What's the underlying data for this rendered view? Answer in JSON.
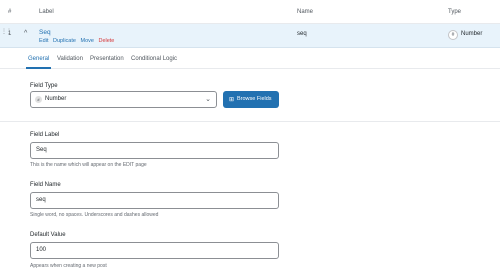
{
  "header": {
    "col_order": "#",
    "col_label": "Label",
    "col_name": "Name",
    "col_type": "Type"
  },
  "field_row": {
    "order": "1",
    "label": "Seq",
    "actions": {
      "edit": "Edit",
      "duplicate": "Duplicate",
      "move": "Move",
      "delete": "Delete"
    },
    "name": "seq",
    "type": "Number",
    "type_icon": "hash-icon"
  },
  "tabs": [
    {
      "label": "General",
      "active": true
    },
    {
      "label": "Validation",
      "active": false
    },
    {
      "label": "Presentation",
      "active": false
    },
    {
      "label": "Conditional Logic",
      "active": false
    }
  ],
  "field_type": {
    "label": "Field Type",
    "value": "Number",
    "browse_label": "Browse Fields"
  },
  "field_label": {
    "label": "Field Label",
    "value": "Seq",
    "help": "This is the name which will appear on the EDIT page"
  },
  "field_name": {
    "label": "Field Name",
    "value": "seq",
    "help": "Single word, no spaces. Underscores and dashes allowed"
  },
  "default_value": {
    "label": "Default Value",
    "value": "100",
    "help": "Appears when creating a new post"
  },
  "colors": {
    "accent": "#2271b1",
    "delete": "#d63638",
    "row_bg": "#e8f3fb"
  }
}
